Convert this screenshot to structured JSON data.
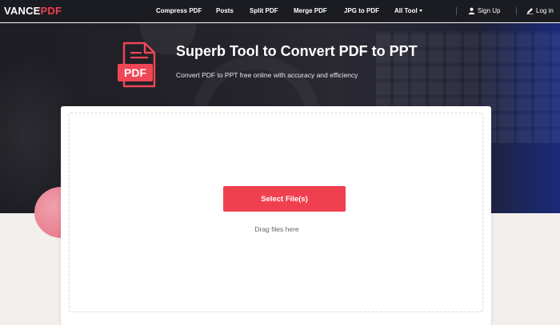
{
  "brand": {
    "part1": "VANCE",
    "part2": "PDF",
    "accent_color": "#ef3e4c"
  },
  "nav": {
    "links": [
      "Compress PDF",
      "Posts",
      "Split PDF",
      "Merge PDF",
      "JPG to PDF",
      "All Tool"
    ],
    "sign_up": "Sign Up",
    "log_in": "Log in"
  },
  "hero": {
    "icon_label": "PDF",
    "title": "Superb Tool to Convert PDF to PPT",
    "subtitle": "Convert PDF to PPT free online with accuracy and efficiency"
  },
  "upload": {
    "button_label": "Select File(s)",
    "drag_hint": "Drag files here",
    "button_color": "#f0404f"
  },
  "icons": [
    "user-icon",
    "pencil-icon",
    "chevron-down-icon",
    "pdf-file-icon"
  ]
}
